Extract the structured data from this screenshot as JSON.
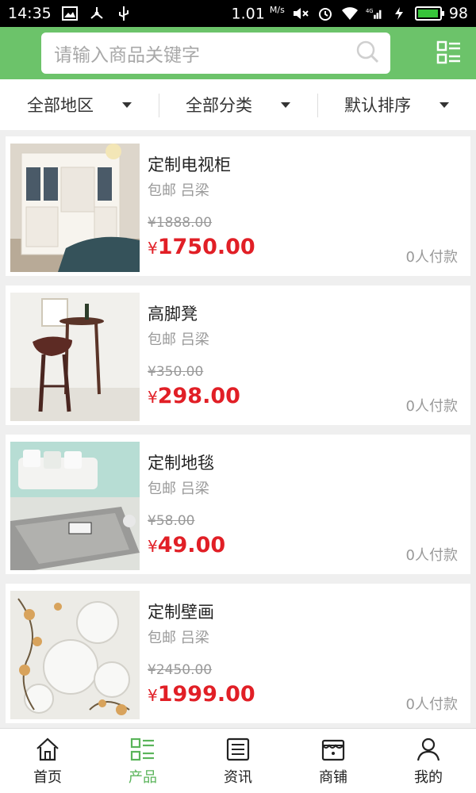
{
  "status_bar": {
    "time": "14:35",
    "speed": "1.01",
    "speed_unit": "M/s",
    "network": "4G",
    "battery": "98",
    "battery_level": 0.98
  },
  "header": {
    "search_placeholder": "请输入商品关键字",
    "search_icon": "search-icon",
    "menu_icon": "list-menu-icon",
    "bg_color": "#6cc36a"
  },
  "filters": [
    {
      "label": "全部地区"
    },
    {
      "label": "全部分类"
    },
    {
      "label": "默认排序"
    }
  ],
  "products": [
    {
      "name": "定制电视柜",
      "shipping": "包邮 吕梁",
      "old_price": "¥1888.00",
      "currency": "¥",
      "price": "1750.00",
      "sales": "0人付款"
    },
    {
      "name": "高脚凳",
      "shipping": "包邮 吕梁",
      "old_price": "¥350.00",
      "currency": "¥",
      "price": "298.00",
      "sales": "0人付款"
    },
    {
      "name": "定制地毯",
      "shipping": "包邮 吕梁",
      "old_price": "¥58.00",
      "currency": "¥",
      "price": "49.00",
      "sales": "0人付款"
    },
    {
      "name": "定制壁画",
      "shipping": "包邮 吕梁",
      "old_price": "¥2450.00",
      "currency": "¥",
      "price": "1999.00",
      "sales": "0人付款"
    }
  ],
  "bottom_nav": [
    {
      "label": "首页",
      "icon": "home-icon",
      "active": false
    },
    {
      "label": "产品",
      "icon": "product-grid-icon",
      "active": true
    },
    {
      "label": "资讯",
      "icon": "news-icon",
      "active": false
    },
    {
      "label": "商铺",
      "icon": "shop-icon",
      "active": false
    },
    {
      "label": "我的",
      "icon": "user-icon",
      "active": false
    }
  ],
  "colors": {
    "accent": "#6cc36a",
    "price": "#e11f26",
    "active_nav": "#5ab45a"
  }
}
